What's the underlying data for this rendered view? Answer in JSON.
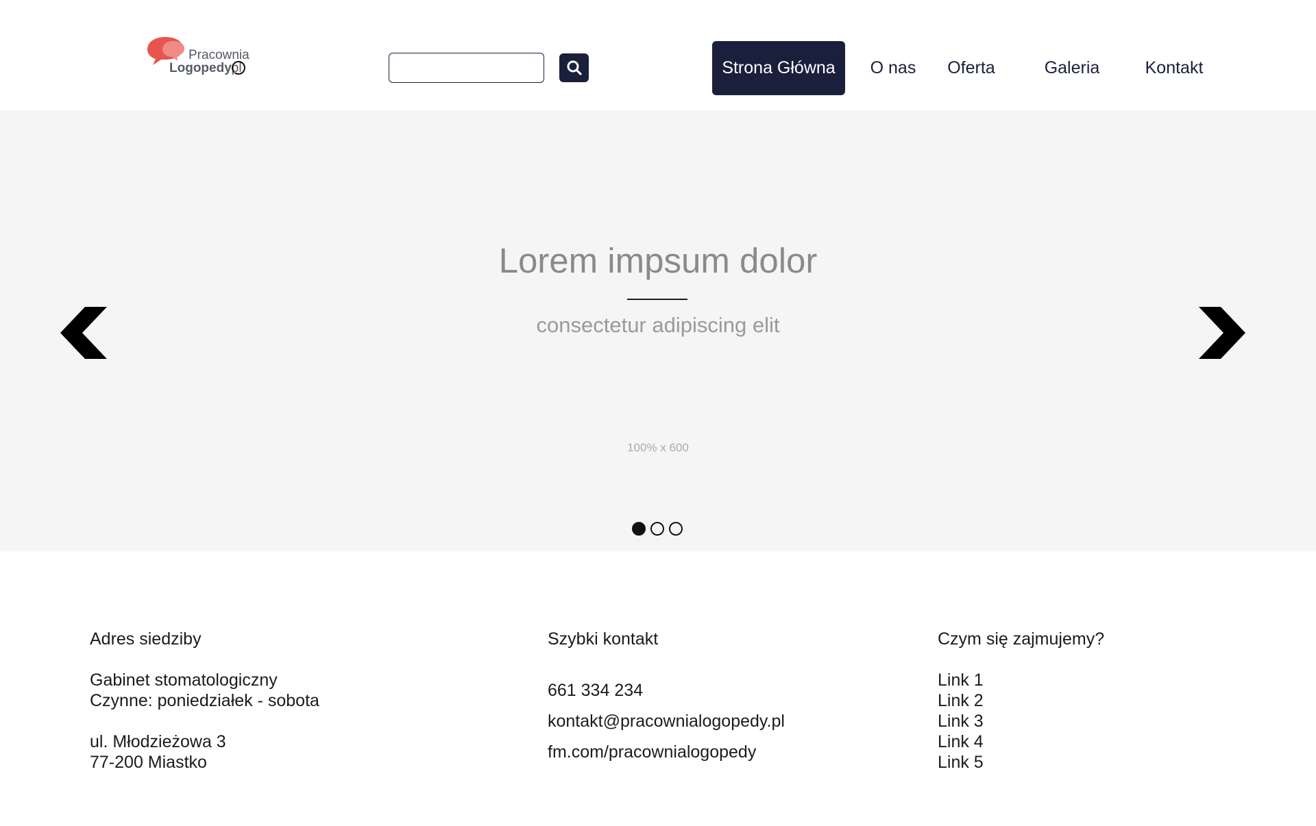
{
  "header": {
    "logo": {
      "line1": "Pracownia",
      "brand": "Logopedy",
      "dot": ".",
      "tld": "pl",
      "colors": {
        "bubble_dark": "#e8544e",
        "bubble_light": "#ef8a86",
        "text": "#555a63"
      }
    },
    "search": {
      "value": "",
      "placeholder": "",
      "button_icon": "search-icon"
    },
    "nav": [
      {
        "label": "Strona Główna",
        "active": true
      },
      {
        "label": "O nas",
        "active": false
      },
      {
        "label": "Oferta",
        "active": false
      },
      {
        "label": "Galeria",
        "active": false
      },
      {
        "label": "Kontakt",
        "active": false
      }
    ],
    "colors": {
      "primary": "#1a1f3c"
    }
  },
  "hero": {
    "title": "Lorem impsum dolor",
    "subtitle": "consectetur adipiscing elit",
    "placeholder_size": "100% x 600",
    "prev_icon": "chevron-left-icon",
    "next_icon": "chevron-right-icon",
    "slides_count": 3,
    "active_slide": 1,
    "background": "#f5f5f5"
  },
  "footer": {
    "address": {
      "heading": "Adres siedziby",
      "line1": "Gabinet stomatologiczny",
      "line2": "Czynne: poniedziałek - sobota",
      "line3": "ul. Młodzieżowa 3",
      "line4": "77-200 Miastko"
    },
    "contact": {
      "heading": "Szybki kontakt",
      "phone": "661 334 234",
      "email": "kontakt@pracownialogopedy.pl",
      "facebook": "fm.com/pracownialogopedy"
    },
    "links": {
      "heading": "Czym się zajmujemy?",
      "items": [
        "Link 1",
        "Link 2",
        "Link 3",
        "Link 4",
        "Link 5"
      ]
    }
  }
}
